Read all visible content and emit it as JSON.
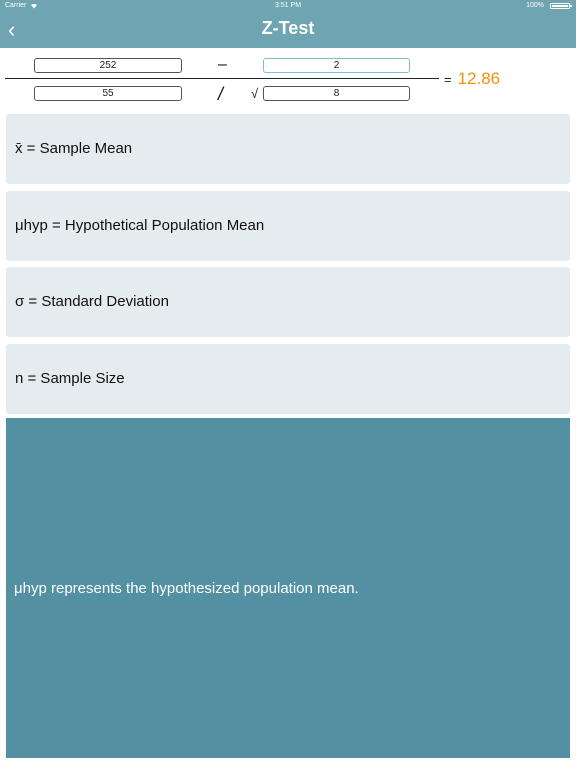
{
  "status_bar": {
    "carrier": "Carrier",
    "wifi_icon": "wifi-icon",
    "time": "3:51 PM",
    "battery": "100%"
  },
  "nav": {
    "back_icon": "chevron-left-icon",
    "back_glyph": "‹",
    "title": "Z-Test"
  },
  "formula": {
    "sample_mean": "252",
    "hyp_mean": "2",
    "std_dev": "55",
    "sample_size": "8",
    "minus": "–",
    "divide": "/",
    "sqrt": "√",
    "equals": "=",
    "result": "12.86"
  },
  "definitions": [
    {
      "label": "x̄ = Sample Mean"
    },
    {
      "label": "μhyp = Hypothetical Population Mean"
    },
    {
      "label": "σ = Standard Deviation"
    },
    {
      "label": "n = Sample Size"
    }
  ],
  "info": {
    "text": "μhyp represents the hypothesized population mean."
  },
  "colors": {
    "nav_background": "#6fa4b3",
    "card_background": "#e5ecef",
    "info_background": "#5290a2",
    "result_accent": "#f4900c"
  }
}
